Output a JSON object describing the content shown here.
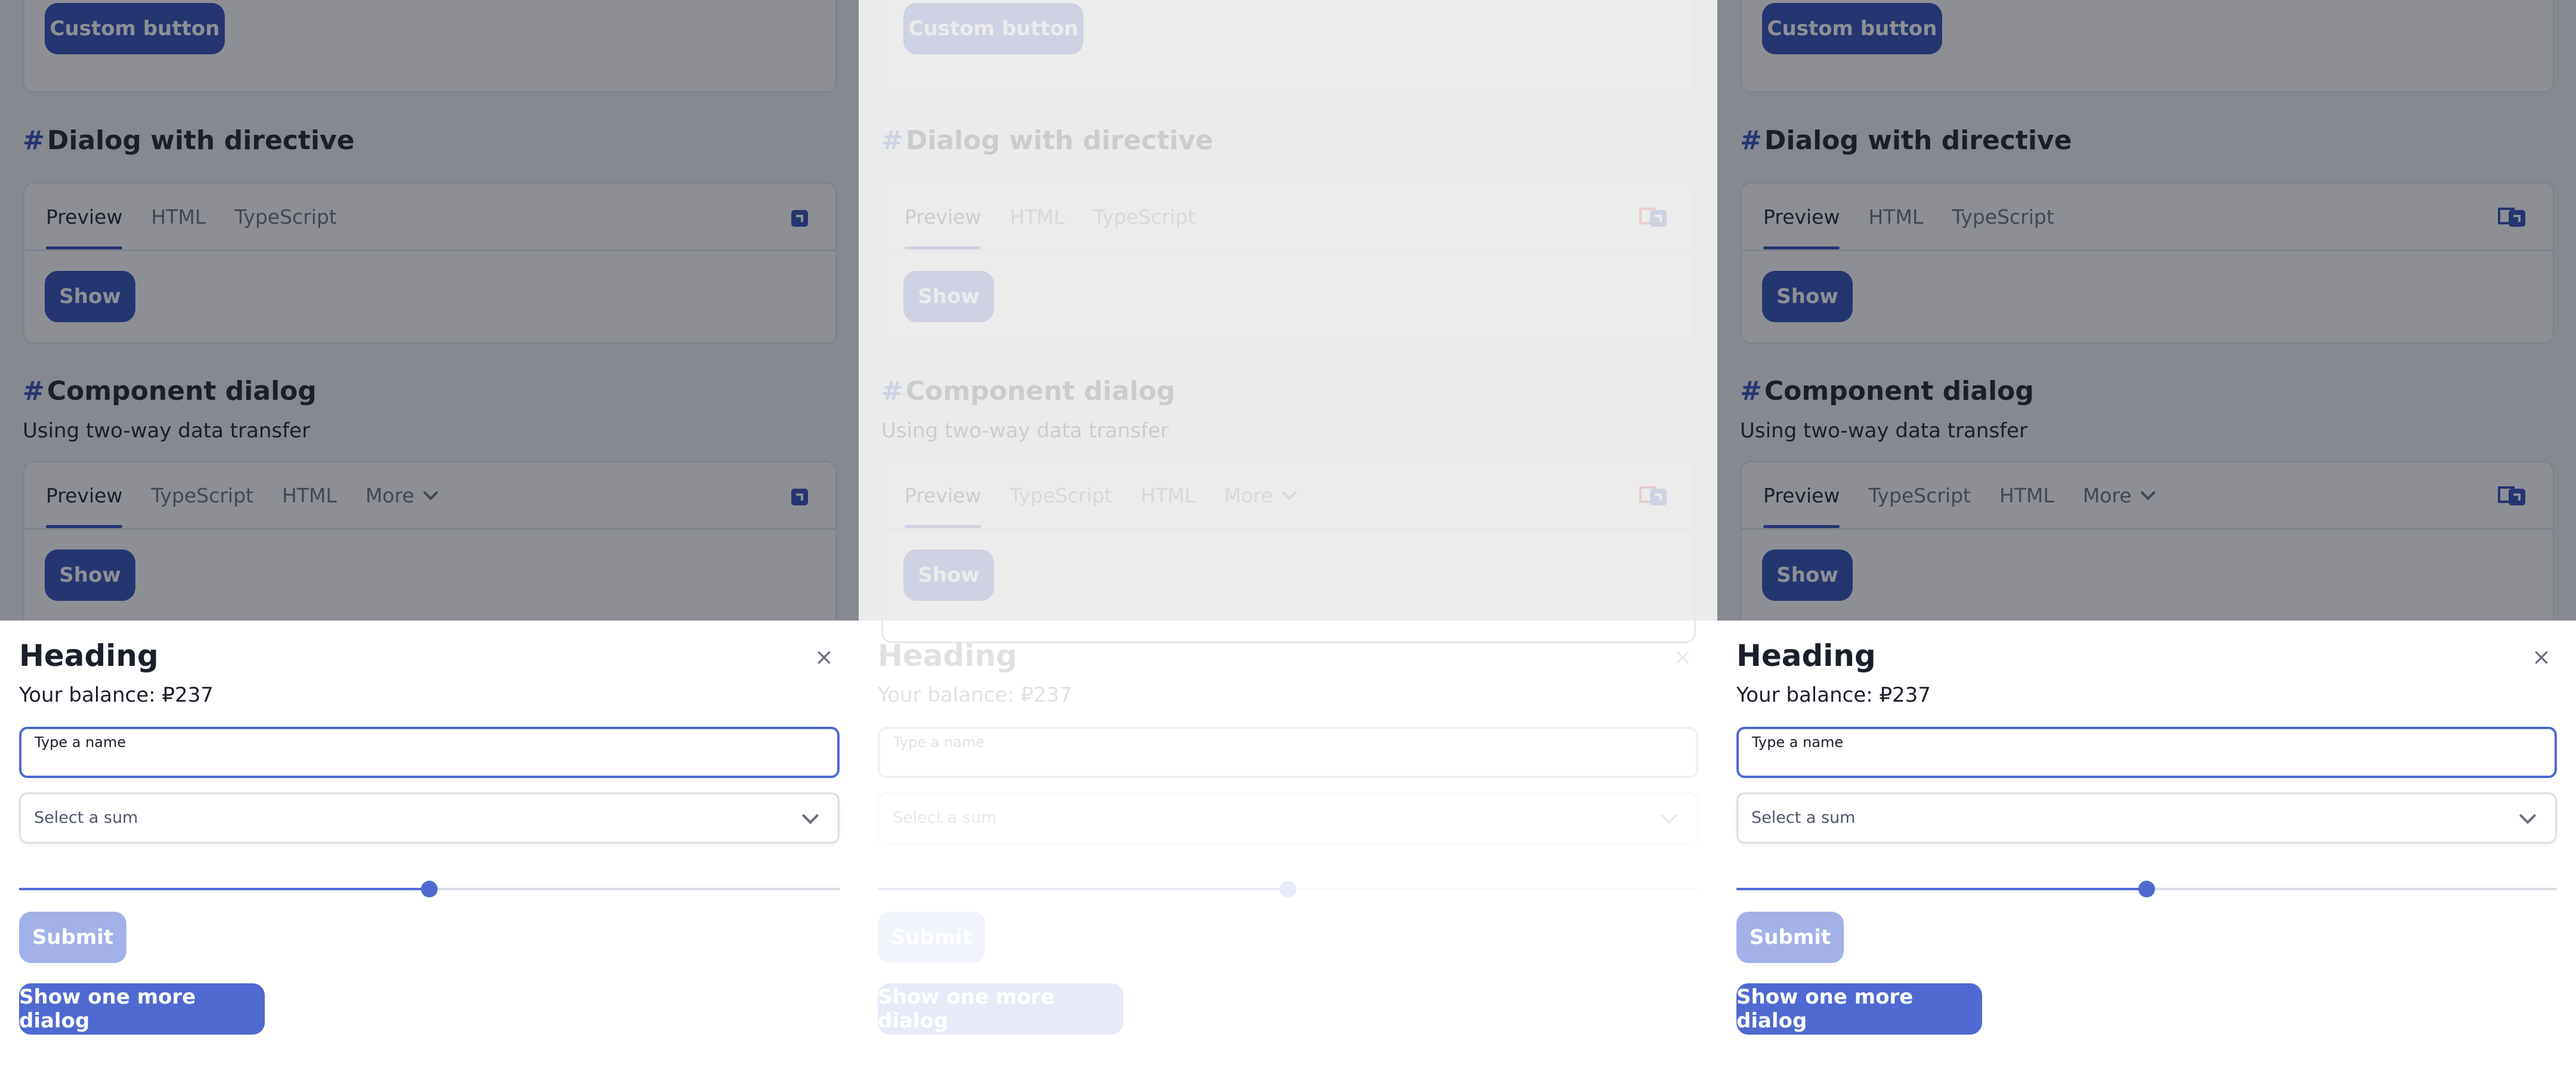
{
  "page": {
    "custom_button_label": "Custom button",
    "sections": [
      {
        "title_hash": "#",
        "title": "Dialog with directive",
        "tabs": [
          "Preview",
          "HTML",
          "TypeScript"
        ],
        "show_label": "Show"
      },
      {
        "title_hash": "#",
        "title": "Component dialog",
        "subtitle": "Using two-way data transfer",
        "tabs": [
          "Preview",
          "TypeScript",
          "HTML",
          "More"
        ],
        "show_label": "Show"
      }
    ]
  },
  "dialog": {
    "heading": "Heading",
    "close_glyph": "×",
    "balance_text": "Your balance: ₽237",
    "name_label": "Type a name",
    "sum_placeholder": "Select a sum",
    "slider_level": 0.5,
    "submit_label": "Submit",
    "more_label": "Show one more dialog"
  },
  "icons": {
    "expand": "expand-icon",
    "open_new": "open-in-new-icon",
    "close": "close-icon",
    "chevron": "chevron-down-icon"
  },
  "colors": {
    "accent": "#4e6ad0",
    "accent_dark": "#2f4bb5",
    "submit_disabled": "#a3b1e8",
    "highlight_red": "#e0301e"
  }
}
